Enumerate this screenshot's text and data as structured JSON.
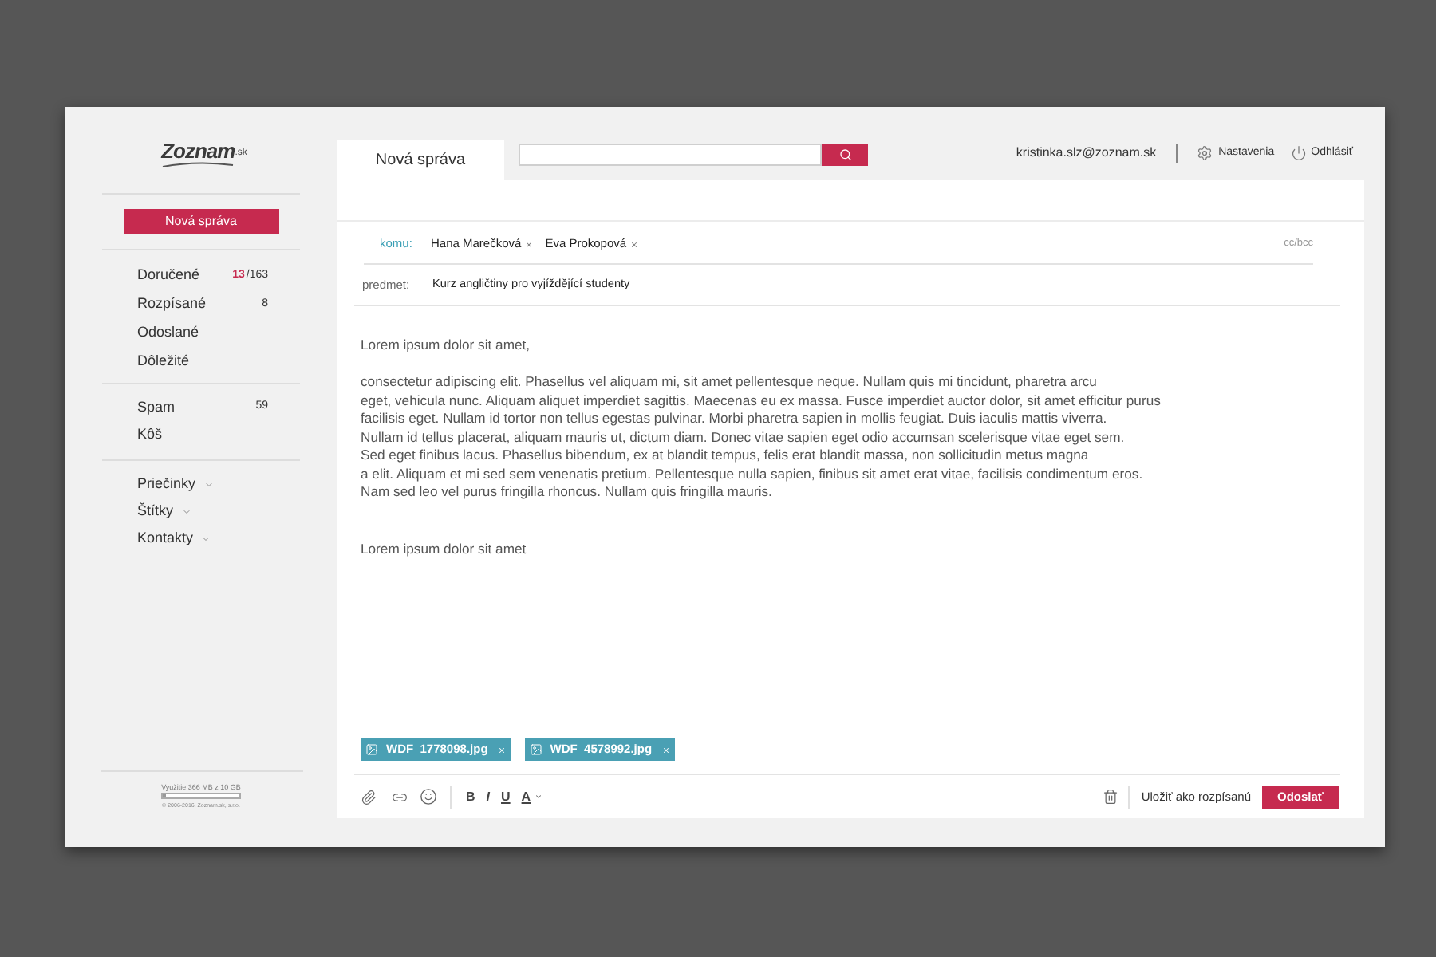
{
  "sidebar": {
    "logo": {
      "name": "Zoznam",
      "suffix": ".sk"
    },
    "compose_button": "Nová správa",
    "folder_groups": [
      {
        "items": [
          {
            "label": "Doručené",
            "unread": "13",
            "total": "/163"
          },
          {
            "label": "Rozpísané",
            "count": "8"
          },
          {
            "label": "Odoslané"
          },
          {
            "label": "Dôležité"
          }
        ]
      },
      {
        "items": [
          {
            "label": "Spam",
            "count": "59"
          },
          {
            "label": "Kôš"
          }
        ]
      },
      {
        "items": [
          {
            "label": "Priečinky",
            "expanded": false
          },
          {
            "label": "Štítky",
            "expanded": false
          },
          {
            "label": "Kontakty",
            "expanded": false
          }
        ]
      }
    ],
    "storage": {
      "label": "Využitie 366 MB z 10 GB",
      "level": 0.05
    },
    "copyright": "© 2006-2016, Zoznam.sk, s.r.o."
  },
  "header": {
    "tabs": [
      {
        "label": "Nová správa",
        "selected": true
      }
    ],
    "user_email": "kristinka.slz@zoznam.sk",
    "settings": "Nastavenia",
    "logout": "Odhlásiť"
  },
  "compose": {
    "to": {
      "label": "komu:",
      "recipients": [
        {
          "name": "Hana Marečková"
        },
        {
          "name": "Eva Prokopová"
        }
      ],
      "cc_bcc": "cc/bcc"
    },
    "subject": {
      "label": "predmet:",
      "value": "Kurz angličtiny pro vyjíždějící studenty"
    },
    "body": {
      "greeting": "Lorem ipsum dolor sit amet,",
      "paragraph": [
        "consectetur adipiscing elit. Phasellus vel aliquam mi, sit amet pellentesque neque. Nullam quis mi tincidunt, pharetra arcu",
        "eget, vehicula nunc. Aliquam aliquet imperdiet sagittis. Maecenas eu ex massa. Fusce imperdiet auctor dolor, sit amet efficitur purus",
        "facilisis eget. Nullam id tortor non tellus egestas pulvinar. Morbi pharetra sapien in mollis feugiat. Duis iaculis mattis viverra.",
        "Nullam id tellus placerat, aliquam mauris ut, dictum diam. Donec vitae sapien eget odio accumsan scelerisque vitae eget sem.",
        "Sed eget finibus lacus. Phasellus bibendum, ex at blandit tempus, felis erat blandit massa, non sollicitudin metus magna",
        "a elit. Aliquam et mi sed sem venenatis pretium. Pellentesque nulla sapien, finibus sit amet erat vitae, facilisis condimentum eros.",
        "Nam sed leo vel purus fringilla rhoncus. Nullam quis fringilla mauris."
      ],
      "signature": "Lorem ipsum dolor sit amet"
    },
    "attachments": [
      {
        "name": "WDF_1778098.jpg"
      },
      {
        "name": "WDF_4578992.jpg"
      }
    ],
    "toolbar": {
      "format": [
        {
          "kind": "bold",
          "label": "B"
        },
        {
          "kind": "italic",
          "label": "I"
        },
        {
          "kind": "underline",
          "label": "U"
        },
        {
          "kind": "color",
          "label": "A"
        }
      ],
      "save_draft": "Uložiť ako rozpísanú",
      "send": "Odoslať"
    }
  }
}
